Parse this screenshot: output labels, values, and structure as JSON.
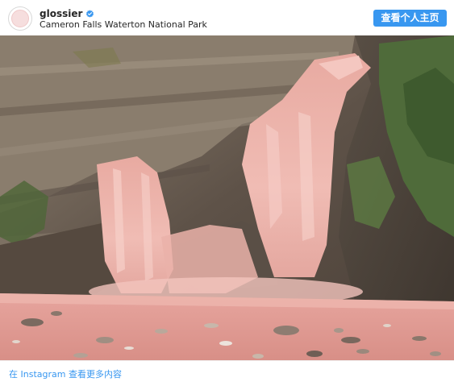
{
  "post": {
    "username": "glossier",
    "verified": true,
    "location": "Cameron Falls Waterton National Park",
    "view_profile_label": "查看个人主页",
    "footer_link": "在 Instagram 查看更多内容"
  },
  "icons": {
    "verified": "verified-badge-icon"
  },
  "colors": {
    "accent": "#3897f0",
    "water": "#e3a39c",
    "rock": "#6b5d52",
    "vegetation": "#4d6b3a"
  }
}
